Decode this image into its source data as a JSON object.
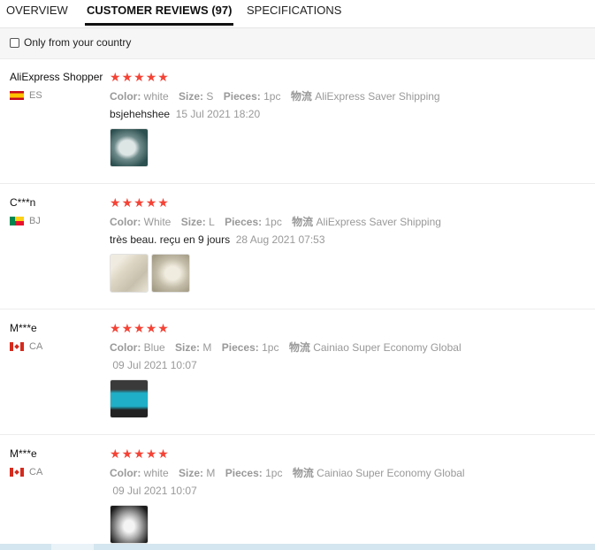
{
  "tabs": [
    {
      "label": "OVERVIEW"
    },
    {
      "label": "CUSTOMER REVIEWS (97)"
    },
    {
      "label": "SPECIFICATIONS"
    }
  ],
  "filter": {
    "label": "Only from your country",
    "checked": false
  },
  "labels": {
    "color": "Color:",
    "size": "Size:",
    "pieces": "Pieces:",
    "shipping": "物流"
  },
  "star_glyph": "★",
  "reviews": [
    {
      "user": "AliExpress Shopper",
      "country": "ES",
      "flag": "es",
      "rating": 5,
      "color": "white",
      "size": "S",
      "pieces": "1pc",
      "shipping": "AliExpress Saver Shipping",
      "comment": "bsjehehshee",
      "date": "15 Jul 2021 18:20"
    },
    {
      "user": "C***n",
      "country": "BJ",
      "flag": "bj",
      "rating": 5,
      "color": "White",
      "size": "L",
      "pieces": "1pc",
      "shipping": "AliExpress Saver Shipping",
      "comment": "très beau. reçu en 9 jours",
      "date": "28 Aug 2021 07:53"
    },
    {
      "user": "M***e",
      "country": "CA",
      "flag": "ca",
      "rating": 5,
      "color": "Blue",
      "size": "M",
      "pieces": "1pc",
      "shipping": "Cainiao Super Economy Global",
      "comment": "",
      "date": "09 Jul 2021 10:07"
    },
    {
      "user": "M***e",
      "country": "CA",
      "flag": "ca",
      "rating": 5,
      "color": "white",
      "size": "M",
      "pieces": "1pc",
      "shipping": "Cainiao Super Economy Global",
      "comment": "",
      "date": "09 Jul 2021 10:07"
    }
  ],
  "colors": {
    "star": "#f44336",
    "muted": "#999999",
    "text": "#222222"
  }
}
